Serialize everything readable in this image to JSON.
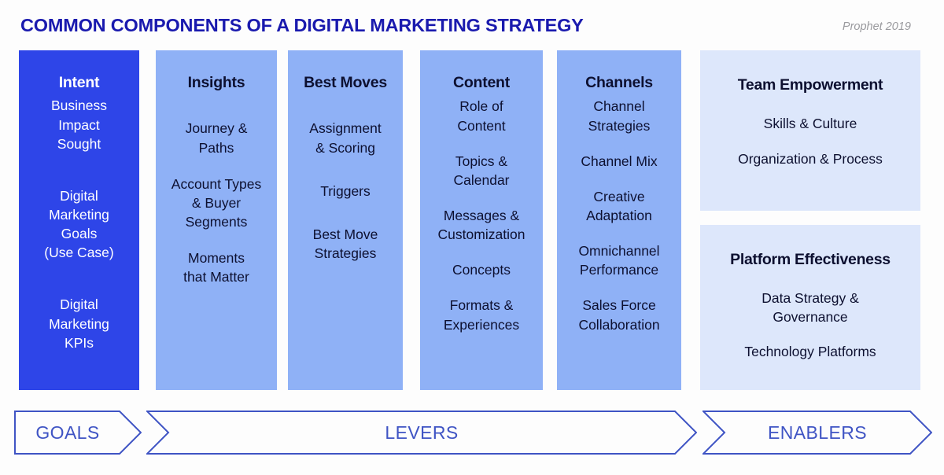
{
  "header": {
    "title": "COMMON COMPONENTS OF A DIGITAL MARKETING STRATEGY",
    "attribution": "Prophet 2019",
    "title_color": "#1a1aae",
    "attribution_color": "#9a9a9e"
  },
  "colors": {
    "goal_fill": "#2e45e8",
    "lever_fill": "#8fb1f6",
    "enabler_fill": "#dde7fb",
    "arrow_stroke": "#3f54c4",
    "arrow_label": "#3f54c4",
    "dark_text": "#0d1030",
    "light_text": "#ffffff"
  },
  "columns": [
    {
      "key": "intent",
      "kind": "goal",
      "heading": "Intent",
      "items": [
        "Business\nImpact\nSought",
        "Digital\nMarketing\nGoals\n(Use Case)",
        "Digital\nMarketing\nKPIs"
      ]
    },
    {
      "key": "insights",
      "kind": "lever",
      "heading": "Insights",
      "items": [
        "Journey &\nPaths",
        "Account Types\n& Buyer\nSegments",
        "Moments\nthat Matter"
      ]
    },
    {
      "key": "best-moves",
      "kind": "lever",
      "heading": "Best Moves",
      "items": [
        "Assignment\n& Scoring",
        "Triggers",
        "Best Move\nStrategies"
      ]
    },
    {
      "key": "content",
      "kind": "lever",
      "heading": "Content",
      "items": [
        "Role of\nContent",
        "Topics &\nCalendar",
        "Messages &\nCustomization",
        "Concepts",
        "Formats &\nExperiences"
      ]
    },
    {
      "key": "channels",
      "kind": "lever",
      "heading": "Channels",
      "items": [
        "Channel\nStrategies",
        "Channel Mix",
        "Creative\nAdaptation",
        "Omnichannel\nPerformance",
        "Sales Force\nCollaboration"
      ]
    }
  ],
  "enablers": [
    {
      "key": "team-empowerment",
      "heading": "Team Empowerment",
      "items": [
        "Skills & Culture",
        "Organization & Process"
      ]
    },
    {
      "key": "platform-effectiveness",
      "heading": "Platform Effectiveness",
      "items": [
        "Data Strategy &\nGovernance",
        "Technology Platforms"
      ]
    }
  ],
  "arrows": [
    {
      "key": "goals",
      "label": "GOALS"
    },
    {
      "key": "levers",
      "label": "LEVERS"
    },
    {
      "key": "enablers",
      "label": "ENABLERS"
    }
  ]
}
